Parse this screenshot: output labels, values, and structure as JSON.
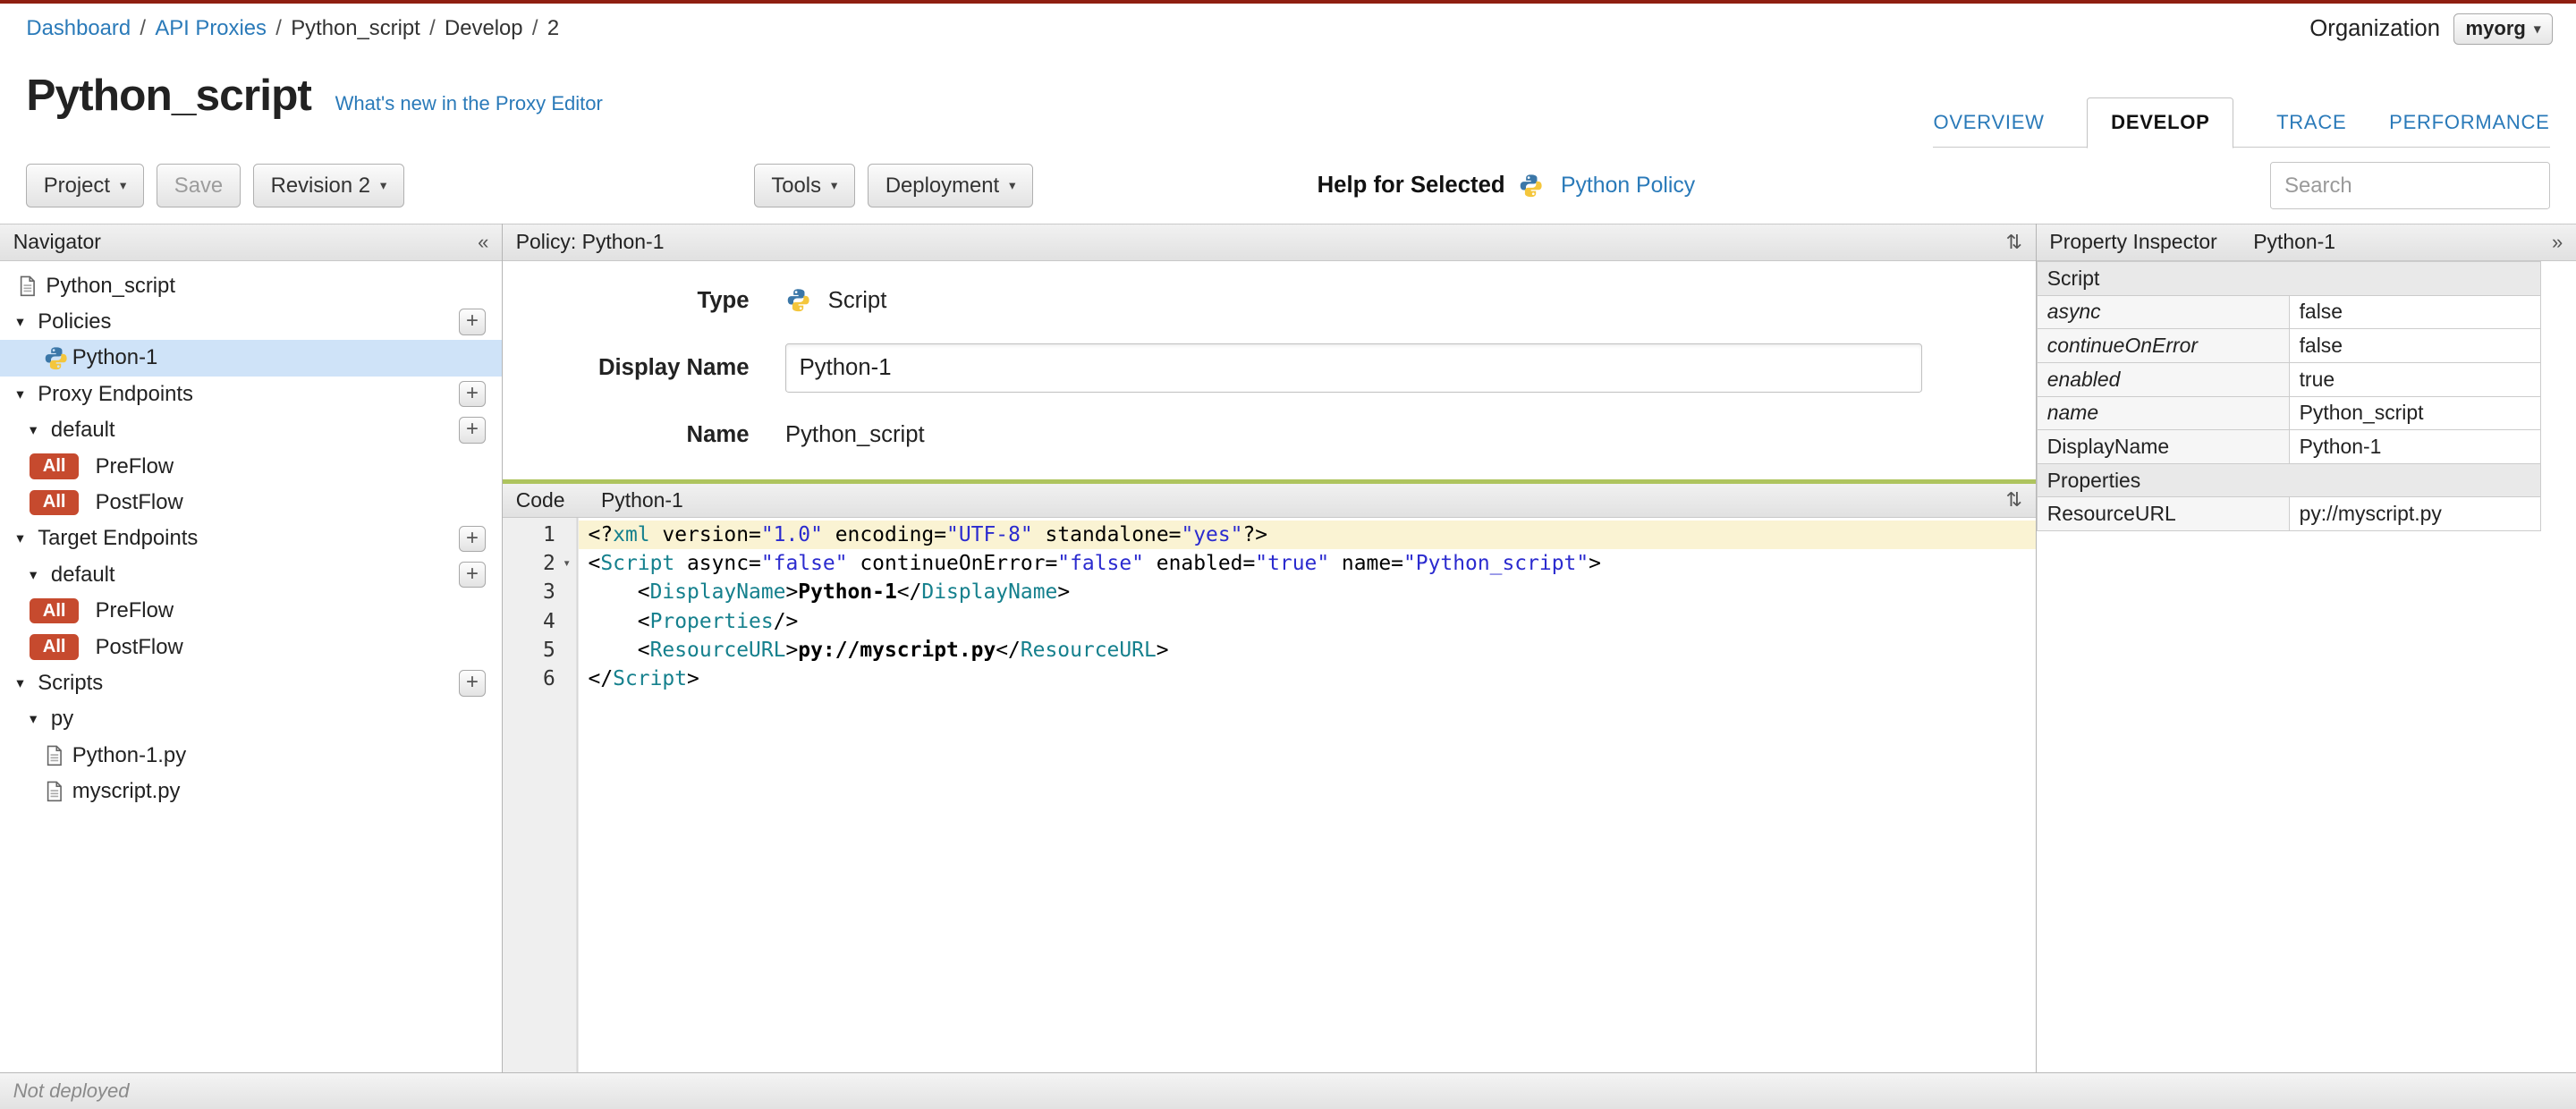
{
  "colors": {
    "top_bar": "#8f1f11",
    "link": "#2a7ab9",
    "badge": "#c64a2e",
    "selected_row": "#cfe3f8",
    "tag": "#15808d",
    "value": "#2b2bcf",
    "line_highlight": "#faf3d3",
    "splitter_green": "#aec45e"
  },
  "breadcrumb": {
    "separator": "/",
    "items": [
      {
        "label": "Dashboard",
        "link": true
      },
      {
        "label": "API Proxies",
        "link": true
      },
      {
        "label": "Python_script",
        "link": false
      },
      {
        "label": "Develop",
        "link": false
      },
      {
        "label": "2",
        "link": false
      }
    ]
  },
  "org": {
    "label": "Organization",
    "value": "myorg"
  },
  "header": {
    "title": "Python_script",
    "whats_new_link": "What's new in the Proxy Editor"
  },
  "tabs": [
    {
      "label": "OVERVIEW",
      "active": false
    },
    {
      "label": "DEVELOP",
      "active": true
    },
    {
      "label": "TRACE",
      "active": false
    },
    {
      "label": "PERFORMANCE",
      "active": false
    }
  ],
  "toolbar": {
    "project": "Project",
    "save": "Save",
    "revision": "Revision 2",
    "tools": "Tools",
    "deployment": "Deployment",
    "help_for_selected": "Help for Selected",
    "help_link": "Python Policy",
    "search_placeholder": "Search"
  },
  "navigator": {
    "title": "Navigator",
    "collapse_icon": "«",
    "items": [
      {
        "id": "python-script-root",
        "label": "Python_script",
        "icon": "file",
        "indent": 0
      },
      {
        "id": "policies",
        "label": "Policies",
        "caret": true,
        "plus": true,
        "indent": 0
      },
      {
        "id": "policy-python-1",
        "label": "Python-1",
        "icon": "python",
        "indent": 2,
        "selected": true
      },
      {
        "id": "proxy-endpoints",
        "label": "Proxy Endpoints",
        "caret": true,
        "plus": true,
        "indent": 0
      },
      {
        "id": "proxy-default",
        "label": "default",
        "caret": true,
        "plus": true,
        "indent": 1
      },
      {
        "id": "proxy-preflow",
        "label": "PreFlow",
        "badge": "All",
        "indent": 1
      },
      {
        "id": "proxy-postflow",
        "label": "PostFlow",
        "badge": "All",
        "indent": 1
      },
      {
        "id": "target-endpoints",
        "label": "Target Endpoints",
        "caret": true,
        "plus": true,
        "indent": 0
      },
      {
        "id": "target-default",
        "label": "default",
        "caret": true,
        "plus": true,
        "indent": 1
      },
      {
        "id": "target-preflow",
        "label": "PreFlow",
        "badge": "All",
        "indent": 1
      },
      {
        "id": "target-postflow",
        "label": "PostFlow",
        "badge": "All",
        "indent": 1
      },
      {
        "id": "scripts",
        "label": "Scripts",
        "caret": true,
        "plus": true,
        "indent": 0
      },
      {
        "id": "scripts-py",
        "label": "py",
        "caret": true,
        "indent": 1
      },
      {
        "id": "file-python-1-py",
        "label": "Python-1.py",
        "icon": "file",
        "indent": 2
      },
      {
        "id": "file-myscript-py",
        "label": "myscript.py",
        "icon": "file",
        "indent": 2
      }
    ]
  },
  "policy_panel": {
    "title": "Policy: Python-1",
    "collapse_icon": "⇅",
    "type_label": "Type",
    "type_value": "Script",
    "display_name_label": "Display Name",
    "display_name_value": "Python-1",
    "name_label": "Name",
    "name_value": "Python_script"
  },
  "code_panel": {
    "title": "Code",
    "subtitle": "Python-1",
    "collapse_icon": "⇅",
    "lines": [
      {
        "n": 1,
        "highlighted": true,
        "tokens": [
          {
            "t": "p",
            "s": "<?"
          },
          {
            "t": "tag",
            "s": "xml"
          },
          {
            "t": "p",
            "s": " version="
          },
          {
            "t": "val",
            "s": "\"1.0\""
          },
          {
            "t": "p",
            "s": " encoding="
          },
          {
            "t": "val",
            "s": "\"UTF-8\""
          },
          {
            "t": "p",
            "s": " standalone="
          },
          {
            "t": "val",
            "s": "\"yes\""
          },
          {
            "t": "p",
            "s": "?>"
          }
        ]
      },
      {
        "n": 2,
        "fold": true,
        "tokens": [
          {
            "t": "p",
            "s": "<"
          },
          {
            "t": "tag",
            "s": "Script"
          },
          {
            "t": "p",
            "s": " async="
          },
          {
            "t": "val",
            "s": "\"false\""
          },
          {
            "t": "p",
            "s": " continueOnError="
          },
          {
            "t": "val",
            "s": "\"false\""
          },
          {
            "t": "p",
            "s": " enabled="
          },
          {
            "t": "val",
            "s": "\"true\""
          },
          {
            "t": "p",
            "s": " name="
          },
          {
            "t": "val",
            "s": "\"Python_script\""
          },
          {
            "t": "p",
            "s": ">"
          }
        ]
      },
      {
        "n": 3,
        "tokens": [
          {
            "t": "p",
            "s": "    <"
          },
          {
            "t": "tag",
            "s": "DisplayName"
          },
          {
            "t": "p",
            "s": ">"
          },
          {
            "t": "text",
            "s": "Python-1"
          },
          {
            "t": "p",
            "s": "</"
          },
          {
            "t": "tag",
            "s": "DisplayName"
          },
          {
            "t": "p",
            "s": ">"
          }
        ]
      },
      {
        "n": 4,
        "tokens": [
          {
            "t": "p",
            "s": "    <"
          },
          {
            "t": "tag",
            "s": "Properties"
          },
          {
            "t": "p",
            "s": "/>"
          }
        ]
      },
      {
        "n": 5,
        "tokens": [
          {
            "t": "p",
            "s": "    <"
          },
          {
            "t": "tag",
            "s": "ResourceURL"
          },
          {
            "t": "p",
            "s": ">"
          },
          {
            "t": "text",
            "s": "py://myscript.py"
          },
          {
            "t": "p",
            "s": "</"
          },
          {
            "t": "tag",
            "s": "ResourceURL"
          },
          {
            "t": "p",
            "s": ">"
          }
        ]
      },
      {
        "n": 6,
        "tokens": [
          {
            "t": "p",
            "s": "</"
          },
          {
            "t": "tag",
            "s": "Script"
          },
          {
            "t": "p",
            "s": ">"
          }
        ]
      }
    ]
  },
  "inspector": {
    "title": "Property Inspector",
    "subtitle": "Python-1",
    "expand_icon": "»",
    "rows": [
      {
        "type": "section",
        "label": "Script"
      },
      {
        "type": "attr",
        "label": "async",
        "value": "false"
      },
      {
        "type": "attr",
        "label": "continueOnError",
        "value": "false"
      },
      {
        "type": "attr",
        "label": "enabled",
        "value": "true"
      },
      {
        "type": "attr",
        "label": "name",
        "value": "Python_script"
      },
      {
        "type": "prop",
        "label": "DisplayName",
        "value": "Python-1"
      },
      {
        "type": "section",
        "label": "Properties"
      },
      {
        "type": "prop",
        "label": "ResourceURL",
        "value": "py://myscript.py"
      }
    ]
  },
  "statusbar": {
    "text": "Not deployed"
  }
}
